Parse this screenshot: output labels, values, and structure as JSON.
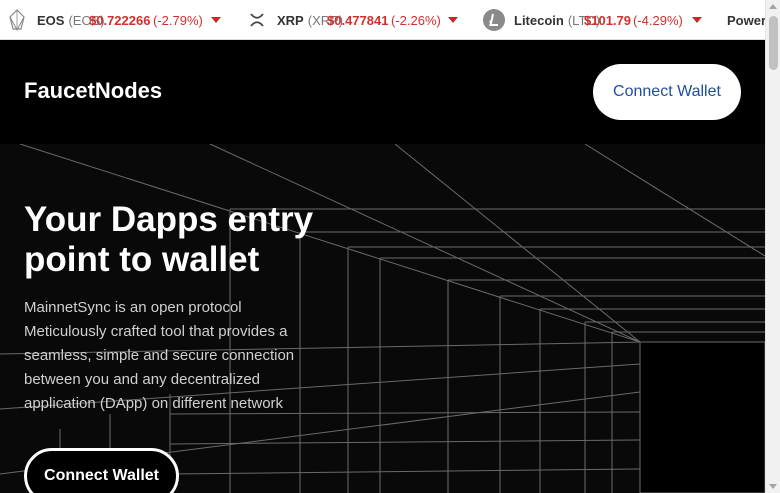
{
  "ticker": [
    {
      "icon": "eos-icon",
      "name": "EOS",
      "symbol": "(EOS)",
      "price": "$0.722266",
      "change": "(-2.79%)"
    },
    {
      "icon": "xrp-icon",
      "name": "XRP",
      "symbol": "(XRP)",
      "price": "$0.477841",
      "change": "(-2.26%)"
    },
    {
      "icon": "litecoin-icon",
      "name": "Litecoin",
      "symbol": "(LTC)",
      "price": "$101.79",
      "change": "(-4.29%)"
    },
    {
      "name": "Power"
    }
  ],
  "header": {
    "brand": "FaucetNodes",
    "cta_label": "Connect Wallet"
  },
  "hero": {
    "title": "Your Dapps entry point to wallet",
    "description": "MainnetSync is an open protocol Meticulously crafted tool that provides a seamless, simple and secure connection between you and any decentralized application (DApp) on different network",
    "cta_label": "Connect Wallet"
  },
  "colors": {
    "negative": "#d32f2f",
    "header_cta_text": "#1f4fa0",
    "background": "#000000"
  }
}
